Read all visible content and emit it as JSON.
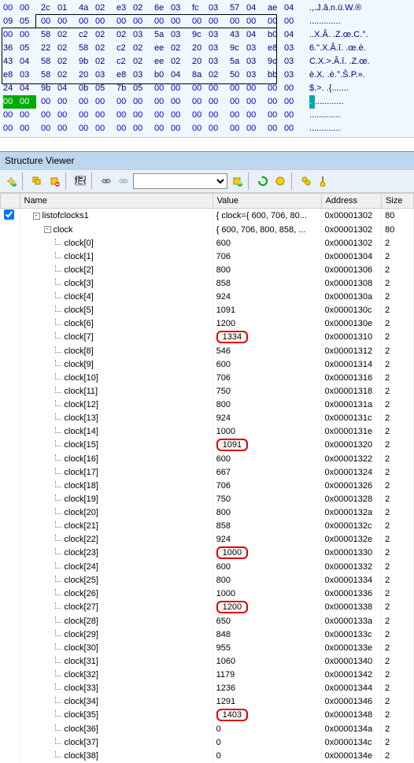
{
  "hex": {
    "rows": [
      {
        "b": [
          "00 00",
          "2c 01",
          "4a 02",
          "e3 02",
          "6e 03",
          "fc 03",
          "57 04",
          "ae 04"
        ],
        "a": ".,.J.â.n.ü.W.®"
      },
      {
        "b": [
          "09 05",
          "00 00",
          "00 00",
          "00 00",
          "00 00",
          "00 00",
          "00 00",
          "00 00"
        ],
        "a": "............."
      },
      {
        "b": [
          "00 00",
          "58 02",
          "c2 02",
          "02 03",
          "5a 03",
          "9c 03",
          "43 04",
          "b0 04"
        ],
        "a": "..X.Â. .Z.œ.C.°."
      },
      {
        "b": [
          "36 05",
          "22 02",
          "58 02",
          "c2 02",
          "ee 02",
          "20 03",
          "9c 03",
          "e8 03"
        ],
        "a": "6.\".X.Â.î. .œ.è."
      },
      {
        "b": [
          "43 04",
          "58 02",
          "9b 02",
          "c2 02",
          "ee 02",
          "20 03",
          "5a 03",
          "9c 03"
        ],
        "a": "C.X.>.Â.î. .Z.œ."
      },
      {
        "b": [
          "e8 03",
          "58 02",
          "20 03",
          "e8 03",
          "b0 04",
          "8a 02",
          "50 03",
          "bb 03"
        ],
        "a": "è.X. .è.°.Š.P.»."
      },
      {
        "b": [
          "24 04",
          "9b 04",
          "0b 05",
          "7b 05",
          "00 00",
          "00 00",
          "00 00",
          "00 00"
        ],
        "a": "$.>. .{......."
      },
      {
        "b": [
          "00 00",
          "00 00",
          "00 00",
          "00 00",
          "00 00",
          "00 00",
          "00 00",
          "00 00"
        ],
        "a": "............."
      },
      {
        "b": [
          "00 00",
          "00 00",
          "00 00",
          "00 00",
          "00 00",
          "00 00",
          "00 00",
          "00 00"
        ],
        "a": "............."
      },
      {
        "b": [
          "00 00",
          "00 00",
          "00 00",
          "00 00",
          "00 00",
          "00 00",
          "00 00",
          "00 00"
        ],
        "a": "............."
      }
    ]
  },
  "panel_title": "Structure Viewer",
  "columns": {
    "name": "Name",
    "value": "Value",
    "address": "Address",
    "size": "Size"
  },
  "rows": [
    {
      "indent": 0,
      "toggle": "-",
      "name": "listofclocks1",
      "value": "{ clock={ 600, 706, 80...",
      "addr": "0x00001302",
      "size": "80",
      "cb": true
    },
    {
      "indent": 1,
      "toggle": "-",
      "name": "clock",
      "value": "{ 600, 706, 800, 858, ...",
      "addr": "0x00001302",
      "size": "80"
    },
    {
      "indent": 2,
      "name": "clock[0]",
      "value": "600",
      "addr": "0x00001302",
      "size": "2"
    },
    {
      "indent": 2,
      "name": "clock[1]",
      "value": "706",
      "addr": "0x00001304",
      "size": "2"
    },
    {
      "indent": 2,
      "name": "clock[2]",
      "value": "800",
      "addr": "0x00001306",
      "size": "2"
    },
    {
      "indent": 2,
      "name": "clock[3]",
      "value": "858",
      "addr": "0x00001308",
      "size": "2"
    },
    {
      "indent": 2,
      "name": "clock[4]",
      "value": "924",
      "addr": "0x0000130a",
      "size": "2"
    },
    {
      "indent": 2,
      "name": "clock[5]",
      "value": "1091",
      "addr": "0x0000130c",
      "size": "2"
    },
    {
      "indent": 2,
      "name": "clock[6]",
      "value": "1200",
      "addr": "0x0000130e",
      "size": "2"
    },
    {
      "indent": 2,
      "name": "clock[7]",
      "value": "1334",
      "addr": "0x00001310",
      "size": "2",
      "hl": true
    },
    {
      "indent": 2,
      "name": "clock[8]",
      "value": "546",
      "addr": "0x00001312",
      "size": "2"
    },
    {
      "indent": 2,
      "name": "clock[9]",
      "value": "600",
      "addr": "0x00001314",
      "size": "2"
    },
    {
      "indent": 2,
      "name": "clock[10]",
      "value": "706",
      "addr": "0x00001316",
      "size": "2"
    },
    {
      "indent": 2,
      "name": "clock[11]",
      "value": "750",
      "addr": "0x00001318",
      "size": "2"
    },
    {
      "indent": 2,
      "name": "clock[12]",
      "value": "800",
      "addr": "0x0000131a",
      "size": "2"
    },
    {
      "indent": 2,
      "name": "clock[13]",
      "value": "924",
      "addr": "0x0000131c",
      "size": "2"
    },
    {
      "indent": 2,
      "name": "clock[14]",
      "value": "1000",
      "addr": "0x0000131e",
      "size": "2"
    },
    {
      "indent": 2,
      "name": "clock[15]",
      "value": "1091",
      "addr": "0x00001320",
      "size": "2",
      "hl": true
    },
    {
      "indent": 2,
      "name": "clock[16]",
      "value": "600",
      "addr": "0x00001322",
      "size": "2"
    },
    {
      "indent": 2,
      "name": "clock[17]",
      "value": "667",
      "addr": "0x00001324",
      "size": "2"
    },
    {
      "indent": 2,
      "name": "clock[18]",
      "value": "706",
      "addr": "0x00001326",
      "size": "2"
    },
    {
      "indent": 2,
      "name": "clock[19]",
      "value": "750",
      "addr": "0x00001328",
      "size": "2"
    },
    {
      "indent": 2,
      "name": "clock[20]",
      "value": "800",
      "addr": "0x0000132a",
      "size": "2"
    },
    {
      "indent": 2,
      "name": "clock[21]",
      "value": "858",
      "addr": "0x0000132c",
      "size": "2"
    },
    {
      "indent": 2,
      "name": "clock[22]",
      "value": "924",
      "addr": "0x0000132e",
      "size": "2"
    },
    {
      "indent": 2,
      "name": "clock[23]",
      "value": "1000",
      "addr": "0x00001330",
      "size": "2",
      "hl": true
    },
    {
      "indent": 2,
      "name": "clock[24]",
      "value": "600",
      "addr": "0x00001332",
      "size": "2"
    },
    {
      "indent": 2,
      "name": "clock[25]",
      "value": "800",
      "addr": "0x00001334",
      "size": "2"
    },
    {
      "indent": 2,
      "name": "clock[26]",
      "value": "1000",
      "addr": "0x00001336",
      "size": "2"
    },
    {
      "indent": 2,
      "name": "clock[27]",
      "value": "1200",
      "addr": "0x00001338",
      "size": "2",
      "hl": true
    },
    {
      "indent": 2,
      "name": "clock[28]",
      "value": "650",
      "addr": "0x0000133a",
      "size": "2"
    },
    {
      "indent": 2,
      "name": "clock[29]",
      "value": "848",
      "addr": "0x0000133c",
      "size": "2"
    },
    {
      "indent": 2,
      "name": "clock[30]",
      "value": "955",
      "addr": "0x0000133e",
      "size": "2"
    },
    {
      "indent": 2,
      "name": "clock[31]",
      "value": "1060",
      "addr": "0x00001340",
      "size": "2"
    },
    {
      "indent": 2,
      "name": "clock[32]",
      "value": "1179",
      "addr": "0x00001342",
      "size": "2"
    },
    {
      "indent": 2,
      "name": "clock[33]",
      "value": "1236",
      "addr": "0x00001344",
      "size": "2"
    },
    {
      "indent": 2,
      "name": "clock[34]",
      "value": "1291",
      "addr": "0x00001346",
      "size": "2"
    },
    {
      "indent": 2,
      "name": "clock[35]",
      "value": "1403",
      "addr": "0x00001348",
      "size": "2",
      "hl": true
    },
    {
      "indent": 2,
      "name": "clock[36]",
      "value": "0",
      "addr": "0x0000134a",
      "size": "2"
    },
    {
      "indent": 2,
      "name": "clock[37]",
      "value": "0",
      "addr": "0x0000134c",
      "size": "2"
    },
    {
      "indent": 2,
      "name": "clock[38]",
      "value": "0",
      "addr": "0x0000134e",
      "size": "2"
    }
  ]
}
